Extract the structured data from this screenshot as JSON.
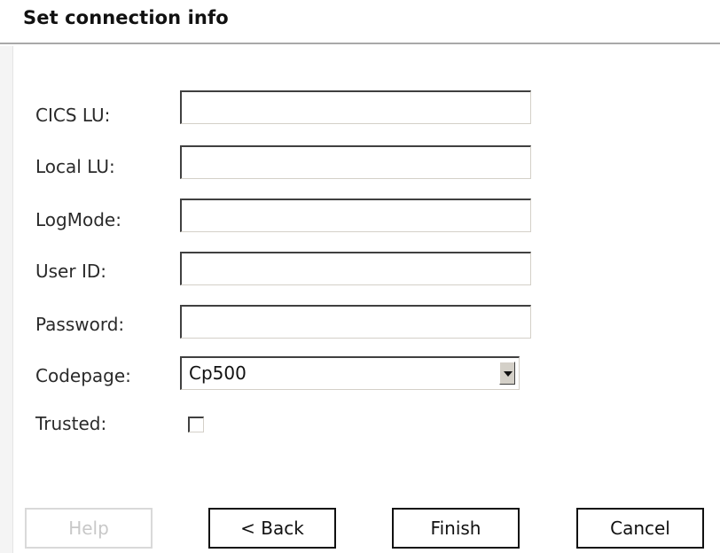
{
  "dialog": {
    "title": "Set connection info"
  },
  "form": {
    "fields": [
      {
        "label": "CICS LU:",
        "value": ""
      },
      {
        "label": "Local LU:",
        "value": ""
      },
      {
        "label": "LogMode:",
        "value": ""
      },
      {
        "label": "User ID:",
        "value": ""
      },
      {
        "label": "Password:",
        "value": ""
      }
    ],
    "codepage": {
      "label": "Codepage:",
      "value": "Cp500"
    },
    "trusted": {
      "label": "Trusted:",
      "checked": false
    }
  },
  "buttons": {
    "help": "Help",
    "back": "< Back",
    "finish": "Finish",
    "cancel": "Cancel"
  }
}
